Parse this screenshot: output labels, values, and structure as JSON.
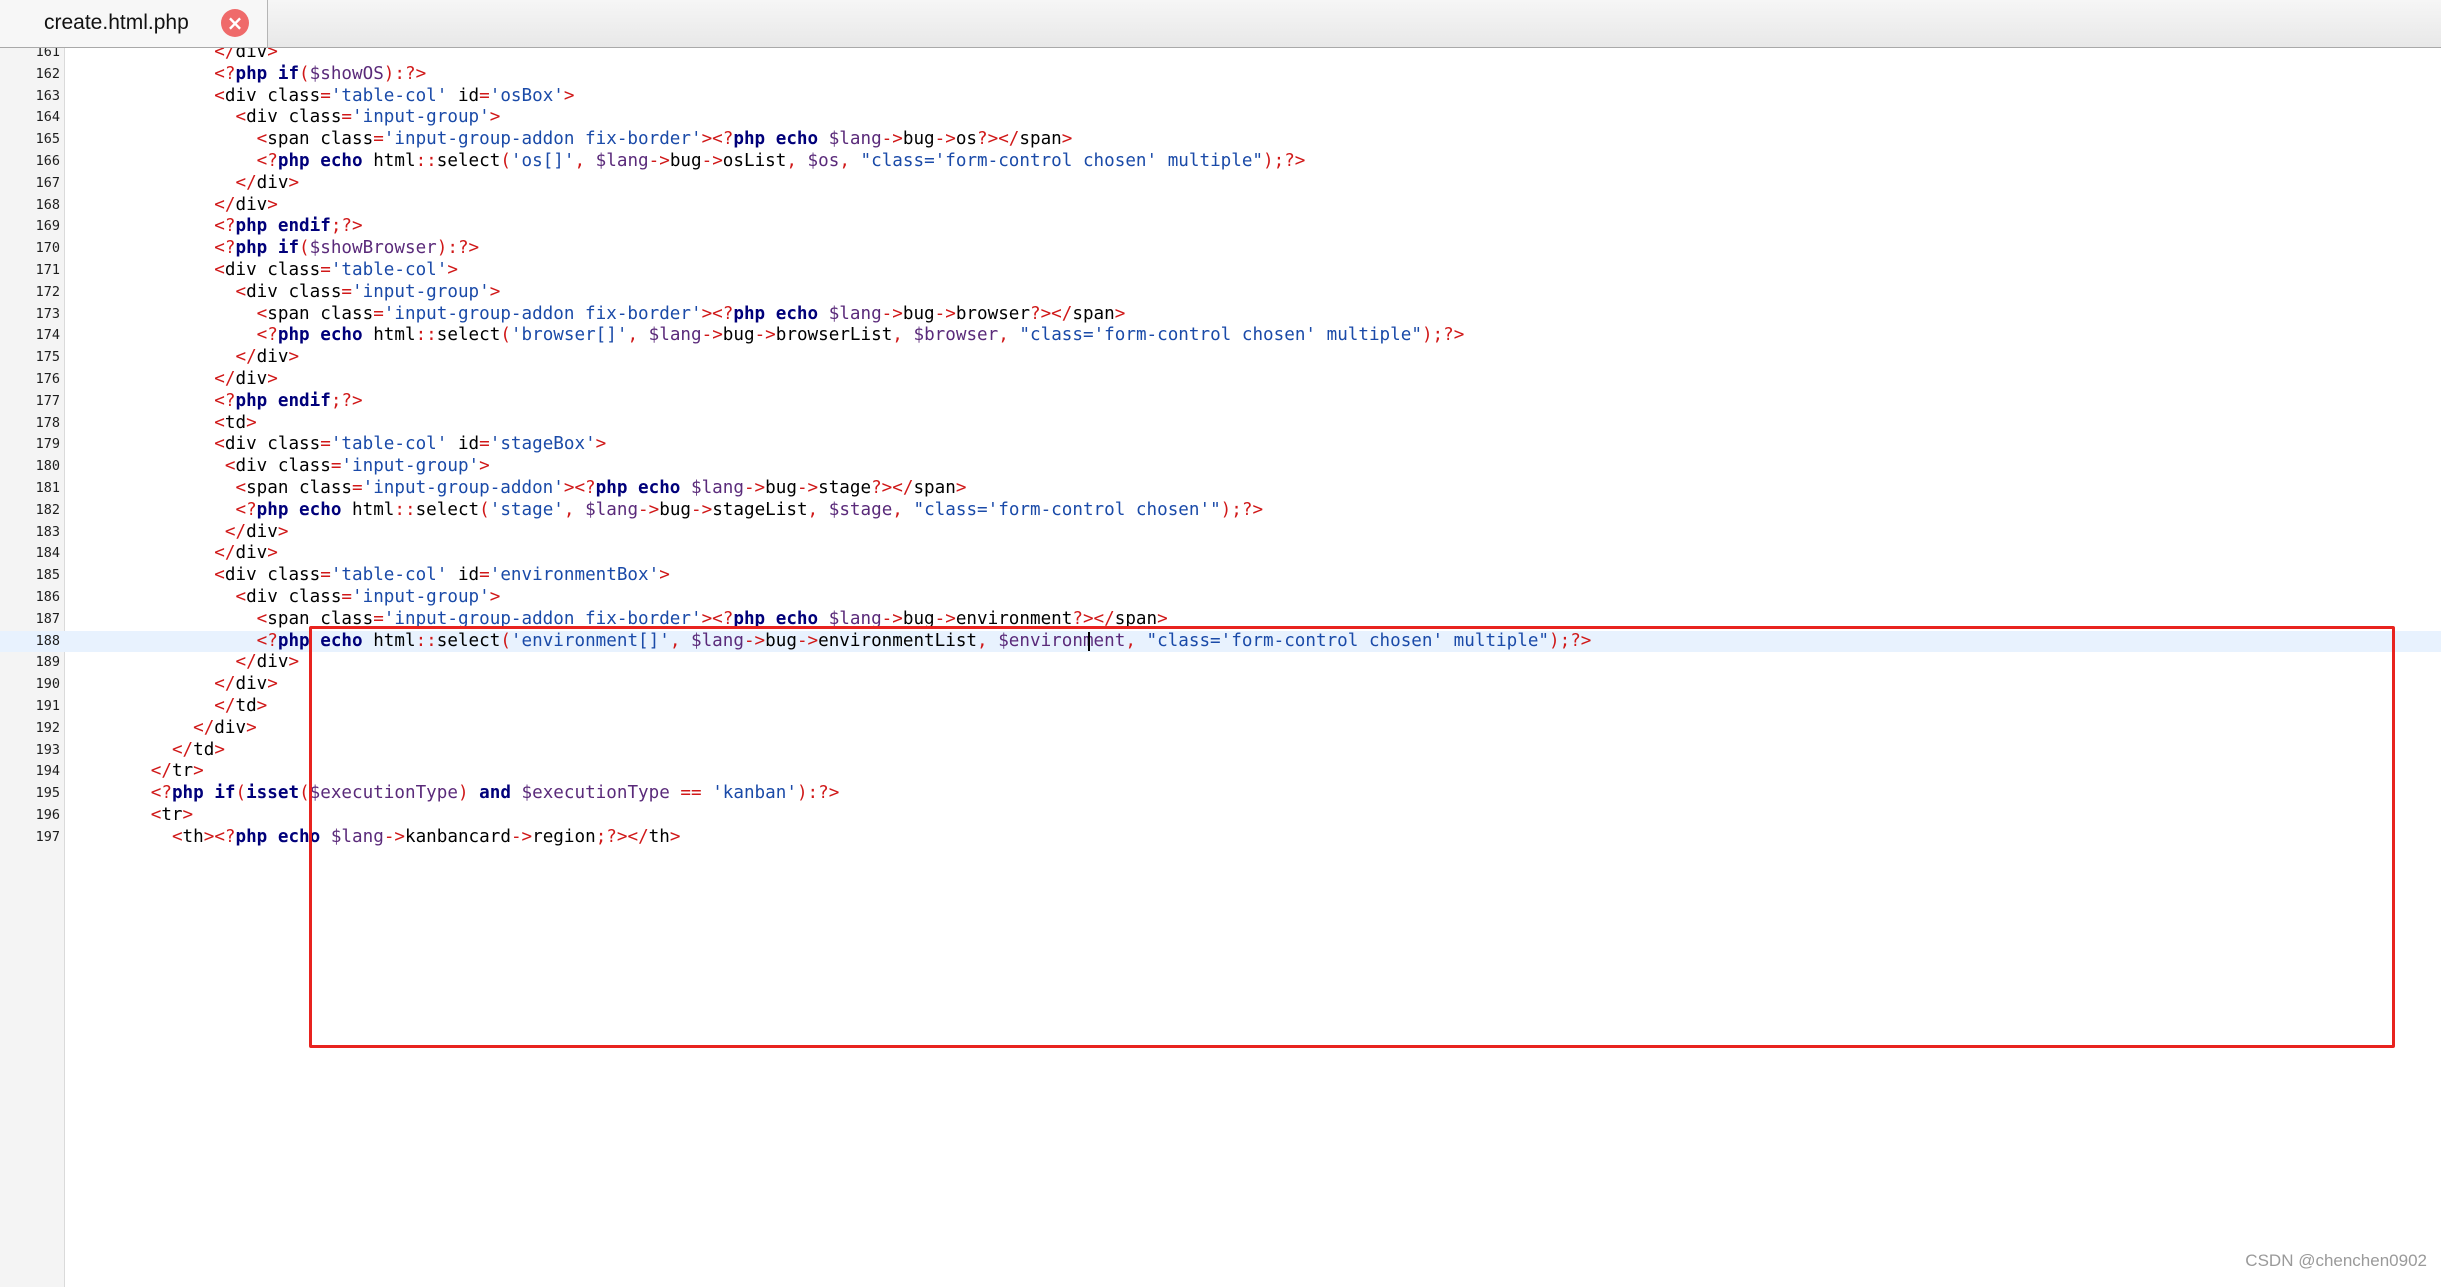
{
  "tab": {
    "title": "create.html.php",
    "close_icon": "close-icon"
  },
  "editor": {
    "current_line": 188,
    "lines": [
      {
        "n": "161",
        "t": "              </div>"
      },
      {
        "n": "162",
        "t": "              <?php if($showOS):?>"
      },
      {
        "n": "163",
        "t": "              <div class='table-col' id='osBox'>"
      },
      {
        "n": "164",
        "t": "                <div class='input-group'>"
      },
      {
        "n": "165",
        "t": "                  <span class='input-group-addon fix-border'><?php echo $lang->bug->os?></span>"
      },
      {
        "n": "166",
        "t": "                  <?php echo html::select('os[]', $lang->bug->osList, $os, \"class='form-control chosen' multiple\");?>"
      },
      {
        "n": "167",
        "t": "                </div>"
      },
      {
        "n": "168",
        "t": "              </div>"
      },
      {
        "n": "169",
        "t": "              <?php endif;?>"
      },
      {
        "n": "170",
        "t": "              <?php if($showBrowser):?>"
      },
      {
        "n": "171",
        "t": "              <div class='table-col'>"
      },
      {
        "n": "172",
        "t": "                <div class='input-group'>"
      },
      {
        "n": "173",
        "t": "                  <span class='input-group-addon fix-border'><?php echo $lang->bug->browser?></span>"
      },
      {
        "n": "174",
        "t": "                  <?php echo html::select('browser[]', $lang->bug->browserList, $browser, \"class='form-control chosen' multiple\");?>"
      },
      {
        "n": "175",
        "t": "                </div>"
      },
      {
        "n": "176",
        "t": "              </div>"
      },
      {
        "n": "177",
        "t": "              <?php endif;?>"
      },
      {
        "n": "178",
        "t": "              <td>"
      },
      {
        "n": "179",
        "t": "              <div class='table-col' id='stageBox'>"
      },
      {
        "n": "180",
        "t": "               <div class='input-group'>"
      },
      {
        "n": "181",
        "t": "                <span class='input-group-addon'><?php echo $lang->bug->stage?></span>"
      },
      {
        "n": "182",
        "t": "                <?php echo html::select('stage', $lang->bug->stageList, $stage, \"class='form-control chosen'\");?>"
      },
      {
        "n": "183",
        "t": "               </div>"
      },
      {
        "n": "184",
        "t": "              </div>"
      },
      {
        "n": "185",
        "t": "              <div class='table-col' id='environmentBox'>"
      },
      {
        "n": "186",
        "t": "                <div class='input-group'>"
      },
      {
        "n": "187",
        "t": "                  <span class='input-group-addon fix-border'><?php echo $lang->bug->environment?></span>"
      },
      {
        "n": "188",
        "t": "                  <?php echo html::select('environment[]', $lang->bug->environmentList, $environment, \"class='form-control chosen' multiple\");?>"
      },
      {
        "n": "189",
        "t": "                </div>"
      },
      {
        "n": "190",
        "t": "              </div>"
      },
      {
        "n": "191",
        "t": "              </td>"
      },
      {
        "n": "192",
        "t": "            </div>"
      },
      {
        "n": "193",
        "t": "          </td>"
      },
      {
        "n": "194",
        "t": "        </tr>"
      },
      {
        "n": "195",
        "t": "        <?php if(isset($executionType) and $executionType == 'kanban'):?>"
      },
      {
        "n": "196",
        "t": "        <tr>"
      },
      {
        "n": "197",
        "t": "          <th><?php echo $lang->kanbancard->region;?></th>"
      }
    ]
  },
  "highlight": {
    "from_line": 178,
    "to_line": 191,
    "color": "#e8231f"
  },
  "watermark": "CSDN @chenchen0902",
  "colors": {
    "keyword": "#00007a",
    "string": "#1a4aa8",
    "variable": "#5a2a7a",
    "operator": "#d01818",
    "current_line_bg": "#e8f2fe"
  }
}
